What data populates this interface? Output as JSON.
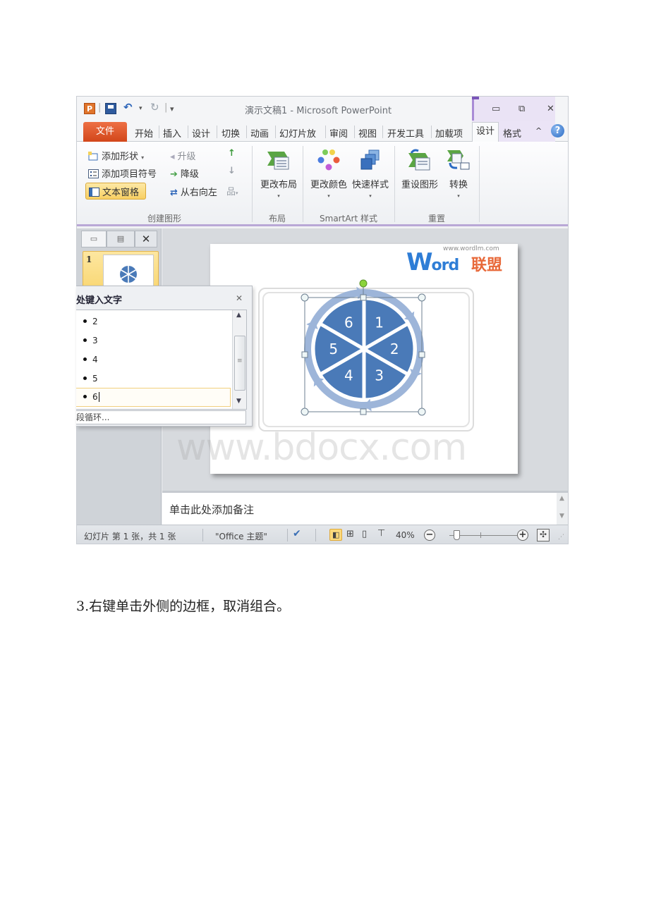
{
  "window": {
    "title": "演示文稿1 - Microsoft PowerPoint",
    "quick_access": {
      "app_icon": "P",
      "save": "save-icon",
      "undo": "undo-icon",
      "redo": "redo-icon",
      "customize": "▾"
    },
    "controls": {
      "minimize": "▭",
      "restore": "⧉",
      "close": "✕"
    }
  },
  "tabs": {
    "file": "文件",
    "items": [
      "开始",
      "插入",
      "设计",
      "切换",
      "动画",
      "幻灯片放",
      "审阅",
      "视图",
      "开发工具",
      "加载项"
    ],
    "context": [
      "设计",
      "格式"
    ],
    "active": "设计",
    "collapse": "^",
    "help": "?"
  },
  "ribbon": {
    "create_graphic": {
      "label": "创建图形",
      "add_shape": "添加形状",
      "add_bullet": "添加项目符号",
      "text_pane": "文本窗格",
      "promote": "升级",
      "demote": "降级",
      "right_to_left": "从右向左",
      "layout_dd": "▾"
    },
    "layouts": {
      "label": "布局",
      "change_layout": "更改布局"
    },
    "smartart_styles": {
      "label": "SmartArt 样式",
      "change_colors": "更改颜色",
      "quick_styles": "快速样式"
    },
    "reset": {
      "label": "重置",
      "reset_graphic": "重设图形",
      "convert": "转换"
    },
    "dropdown_arrow": "▾"
  },
  "slides_panel": {
    "tab_close": "✕",
    "slide_number": "1"
  },
  "slide": {
    "logo_url": "www.wordlm.com",
    "logo_word_w": "W",
    "logo_word_rest": "ord",
    "logo_cn": "联盟",
    "segments": [
      "1",
      "2",
      "3",
      "4",
      "5",
      "6"
    ],
    "colors": {
      "segment": "#4a7ab8",
      "arrow": "#9db5d9",
      "handle_rotate": "#8bd33b"
    }
  },
  "text_pane": {
    "title": "处键入文字",
    "close": "✕",
    "items": [
      "2",
      "3",
      "4",
      "5",
      "6"
    ],
    "active_item": "6",
    "footer": "段循环..."
  },
  "notes": {
    "placeholder": "单击此处添加备注"
  },
  "status_bar": {
    "slide_info": "幻灯片 第 1 张，共 1 张",
    "theme": "\"Office 主题\"",
    "zoom_level": "40%",
    "zoom_minus": "−",
    "zoom_plus": "+",
    "zoom_fraction": 0.1
  },
  "watermark": "www.bdocx.com",
  "caption": "3.右键单击外侧的边框，取消组合。"
}
